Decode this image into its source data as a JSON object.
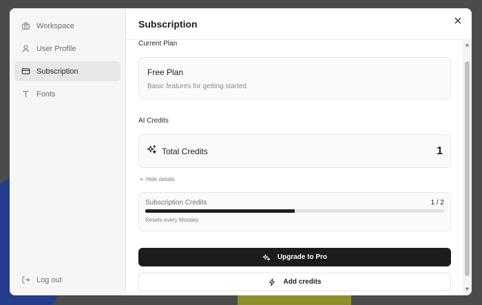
{
  "sidebar": {
    "items": [
      {
        "label": "Workspace",
        "icon": "briefcase-icon"
      },
      {
        "label": "User Profile",
        "icon": "user-icon"
      },
      {
        "label": "Subscription",
        "icon": "credit-card-icon",
        "active": true
      },
      {
        "label": "Fonts",
        "icon": "type-icon"
      }
    ],
    "logout_label": "Log out"
  },
  "header": {
    "title": "Subscription"
  },
  "current_plan": {
    "section_label": "Current Plan",
    "name": "Free Plan",
    "description": "Basic features for getting started"
  },
  "ai_credits": {
    "section_label": "AI Credits",
    "total_label": "Total Credits",
    "total_value": "1",
    "hide_details_label": "Hide details",
    "subscription": {
      "label": "Subscription Credits",
      "count": "1 / 2",
      "progress": 0.5,
      "reset_note": "Resets every Monday"
    }
  },
  "actions": {
    "upgrade_label": "Upgrade to Pro",
    "add_credits_label": "Add credits"
  },
  "colors": {
    "accent": "#1c1c1c",
    "sidebar_bg": "#f6f6f6"
  }
}
